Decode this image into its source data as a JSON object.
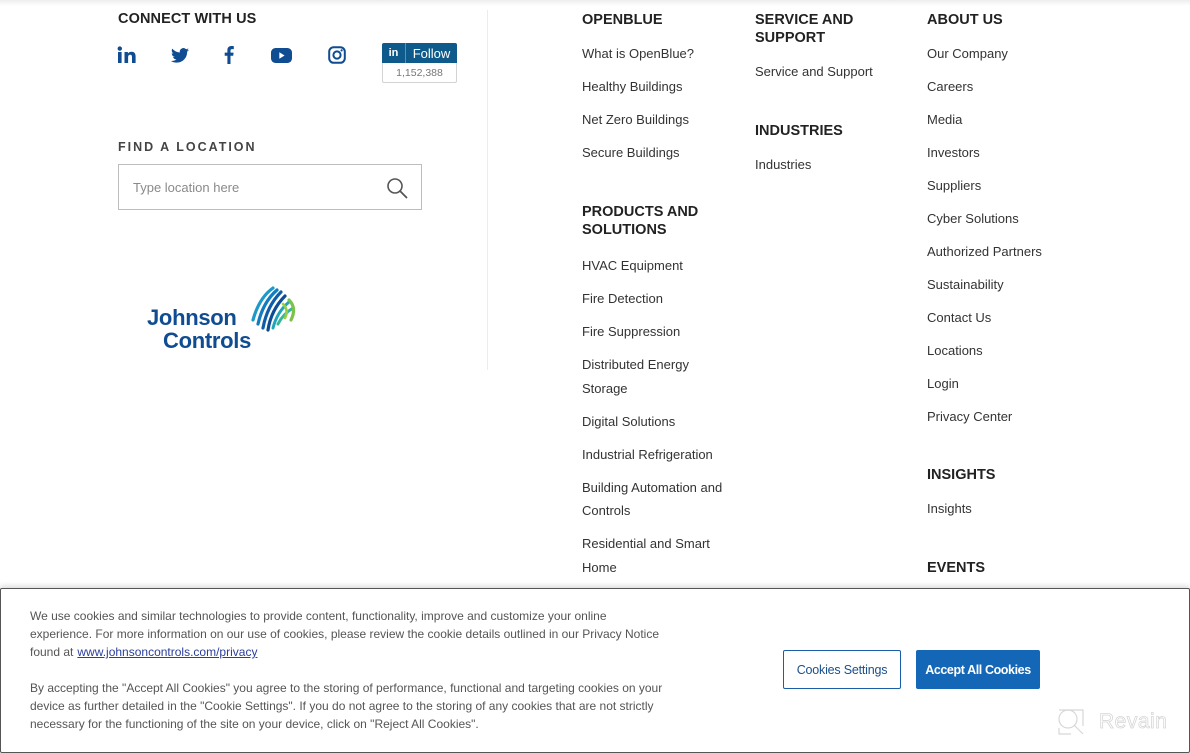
{
  "connect": {
    "title": "CONNECT WITH US",
    "social": [
      {
        "name": "linkedin",
        "icon": "linkedin-icon"
      },
      {
        "name": "twitter",
        "icon": "twitter-icon"
      },
      {
        "name": "facebook",
        "icon": "facebook-icon"
      },
      {
        "name": "youtube",
        "icon": "youtube-icon"
      },
      {
        "name": "instagram",
        "icon": "instagram-icon"
      }
    ],
    "linkedin_follow": {
      "in_label": "in",
      "follow_label": "Follow",
      "follower_count": "1,152,388"
    }
  },
  "find_location": {
    "title": "FIND A LOCATION",
    "placeholder": "Type location here",
    "value": "",
    "search_icon": "search-icon"
  },
  "logo": {
    "line1": "Johnson",
    "line2": "Controls"
  },
  "nav": {
    "openblue": {
      "heading": "OPENBLUE",
      "items": [
        "What is OpenBlue?",
        "Healthy Buildings",
        "Net Zero Buildings",
        "Secure Buildings"
      ]
    },
    "products": {
      "heading": "PRODUCTS AND SOLUTIONS",
      "items": [
        "HVAC Equipment",
        "Fire Detection",
        "Fire Suppression",
        "Distributed Energy Storage",
        "Digital Solutions",
        "Industrial Refrigeration",
        "Building Automation and Controls",
        "Residential and Smart Home"
      ]
    },
    "service": {
      "heading": "SERVICE AND SUPPORT",
      "items": [
        "Service and Support"
      ]
    },
    "industries": {
      "heading": "INDUSTRIES",
      "items": [
        "Industries"
      ]
    },
    "about": {
      "heading": "ABOUT US",
      "items": [
        "Our Company",
        "Careers",
        "Media",
        "Investors",
        "Suppliers",
        "Cyber Solutions",
        "Authorized Partners",
        "Sustainability",
        "Contact Us",
        "Locations",
        "Login",
        "Privacy Center"
      ]
    },
    "insights": {
      "heading": "INSIGHTS",
      "items": [
        "Insights"
      ]
    },
    "events": {
      "heading": "EVENTS"
    }
  },
  "cookie_banner": {
    "paragraph1": "We use cookies and similar technologies to provide content, functionality, improve and customize your online experience. For more information on our use of cookies, please review the cookie details outlined in our Privacy Notice found at",
    "privacy_link": "www.johnsoncontrols.com/privacy",
    "paragraph2": "By accepting the \"Accept All Cookies\" you agree to the storing of performance, functional and targeting cookies on your device as further detailed in the \"Cookie Settings\". If you do not agree to the storing of any cookies that are not strictly necessary for the functioning of the site on your device, click on \"Reject All Cookies\".",
    "settings_button": "Cookies Settings",
    "accept_button": "Accept All Cookies"
  },
  "watermark": {
    "text": "Revain"
  },
  "colors": {
    "brand_blue": "#0f4c91",
    "linkedin_blue": "#0e5a8a",
    "accept_button": "#1466b6",
    "link": "#2b3e9a"
  }
}
